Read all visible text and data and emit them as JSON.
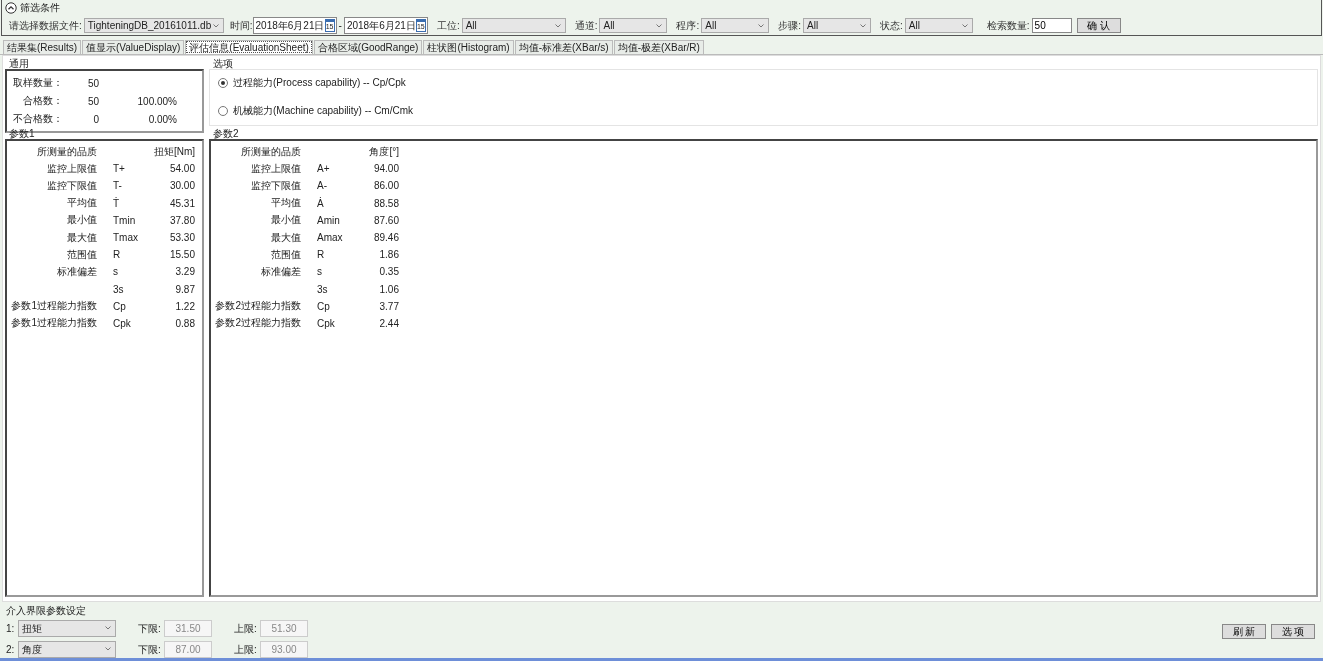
{
  "filter": {
    "title": "筛选条件",
    "file_label": "请选择数据文件:",
    "file": "TighteningDB_20161011.db",
    "time_label": "时间:",
    "dates": [
      {
        "value": "2018年6月21日",
        "icon_text": "15"
      },
      {
        "value": "2018年6月21日",
        "icon_text": "15"
      }
    ],
    "date_sep": "-",
    "selects": [
      {
        "label": "工位:",
        "value": "All"
      },
      {
        "label": "通道:",
        "value": "All"
      },
      {
        "label": "程序:",
        "value": "All"
      },
      {
        "label": "步骤:",
        "value": "All"
      },
      {
        "label": "状态:",
        "value": "All"
      }
    ],
    "count_label": "检索数量:",
    "count": "50",
    "confirm": "确 认"
  },
  "tabs": [
    {
      "label": "结果集(Results)",
      "selected": false
    },
    {
      "label": "值显示(ValueDisplay)",
      "selected": false
    },
    {
      "label": "评估信息(EvaluationSheet)",
      "selected": true
    },
    {
      "label": "合格区域(GoodRange)",
      "selected": false
    },
    {
      "label": "柱状图(Histogram)",
      "selected": false
    },
    {
      "label": "均值-标准差(XBar/s)",
      "selected": false
    },
    {
      "label": "均值-极差(XBar/R)",
      "selected": false
    }
  ],
  "general": {
    "title": "通用",
    "rows": [
      {
        "label": "取样数量：",
        "value": "50"
      },
      {
        "label": "合格数：",
        "value": "50",
        "percent": "100.00%"
      },
      {
        "label": "不合格数：",
        "value": "0",
        "percent": "0.00%"
      }
    ]
  },
  "options": {
    "title": "选项",
    "radios": [
      {
        "label": "过程能力(Process capability) -- Cp/Cpk",
        "selected": true
      },
      {
        "label": "机械能力(Machine capability) -- Cm/Cmk",
        "selected": false
      }
    ]
  },
  "params": [
    {
      "title": "参数1",
      "header_label": "所测量的品质",
      "unit": "扭矩[Nm]",
      "rows": [
        {
          "label": "监控上限值",
          "symbol": "T+",
          "value": "54.00"
        },
        {
          "label": "监控下限值",
          "symbol": "T-",
          "value": "30.00"
        },
        {
          "label": "平均值",
          "symbol": "Ṫ",
          "value": "45.31"
        },
        {
          "label": "最小值",
          "symbol": "Tmin",
          "value": "37.80"
        },
        {
          "label": "最大值",
          "symbol": "Tmax",
          "value": "53.30"
        },
        {
          "label": "范围值",
          "symbol": "R",
          "value": "15.50"
        },
        {
          "label": "标准偏差",
          "symbol": "s",
          "value": "3.29"
        },
        {
          "symbol": "3s",
          "value": "9.87"
        },
        {
          "label": "参数1过程能力指数",
          "symbol": "Cp",
          "value": "1.22"
        },
        {
          "label": "参数1过程能力指数",
          "symbol": "Cpk",
          "value": "0.88"
        }
      ]
    },
    {
      "title": "参数2",
      "header_label": "所测量的品质",
      "unit": "角度[°]",
      "rows": [
        {
          "label": "监控上限值",
          "symbol": "A+",
          "value": "94.00"
        },
        {
          "label": "监控下限值",
          "symbol": "A-",
          "value": "86.00"
        },
        {
          "label": "平均值",
          "symbol": "Ȧ",
          "value": "88.58"
        },
        {
          "label": "最小值",
          "symbol": "Amin",
          "value": "87.60"
        },
        {
          "label": "最大值",
          "symbol": "Amax",
          "value": "89.46"
        },
        {
          "label": "范围值",
          "symbol": "R",
          "value": "1.86"
        },
        {
          "label": "标准偏差",
          "symbol": "s",
          "value": "0.35"
        },
        {
          "symbol": "3s",
          "value": "1.06"
        },
        {
          "label": "参数2过程能力指数",
          "symbol": "Cp",
          "value": "3.77"
        },
        {
          "label": "参数2过程能力指数",
          "symbol": "Cpk",
          "value": "2.44"
        }
      ]
    }
  ],
  "limits": {
    "title": "介入界限参数设定",
    "rows": [
      {
        "index": "1:",
        "param": "扭矩",
        "lower_label": "下限:",
        "lower": "31.50",
        "upper_label": "上限:",
        "upper": "51.30"
      },
      {
        "index": "2:",
        "param": "角度",
        "lower_label": "下限:",
        "lower": "87.00",
        "upper_label": "上限:",
        "upper": "93.00"
      }
    ]
  },
  "buttons": [
    "刷 新",
    "选 项"
  ]
}
